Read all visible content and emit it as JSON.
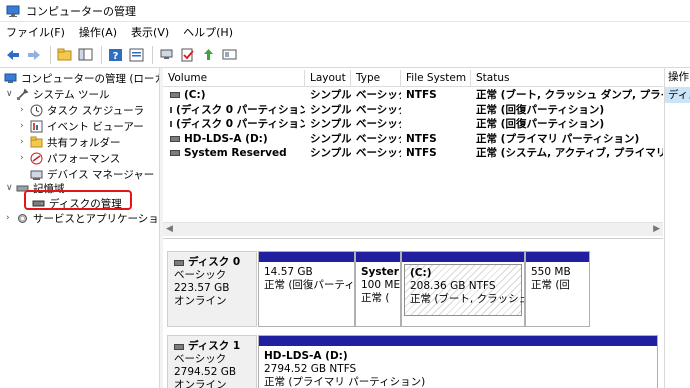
{
  "window": {
    "title": "コンピューターの管理",
    "icon": "computer-management-icon"
  },
  "menu": [
    "ファイル(F)",
    "操作(A)",
    "表示(V)",
    "ヘルプ(H)"
  ],
  "toolbar": {
    "icons": [
      "back-arrow-icon",
      "forward-arrow-icon",
      "up-folder-icon",
      "console-tree-icon",
      "help-icon",
      "properties-icon",
      "connect-icon",
      "check-icon",
      "export-icon",
      "view-icon"
    ]
  },
  "tree": {
    "root": "コンピューターの管理 (ローカル)",
    "system_tools": "システム ツール",
    "task_scheduler": "タスク スケジューラ",
    "event_viewer": "イベント ビューアー",
    "shared_folders": "共有フォルダー",
    "performance": "パフォーマンス",
    "device_manager": "デバイス マネージャー",
    "storage": "記憶域",
    "disk_management": "ディスクの管理",
    "services": "サービスとアプリケーション"
  },
  "volumes": {
    "headers": [
      "Volume",
      "Layout",
      "Type",
      "File System",
      "Status"
    ],
    "rows": [
      {
        "volume": "(C:)",
        "layout": "シンプル",
        "type": "ベーシック",
        "fs": "NTFS",
        "status": "正常 (ブート, クラッシュ ダンプ, プライマリ パ"
      },
      {
        "volume": "(ディスク 0 パーティション 1)",
        "layout": "シンプル",
        "type": "ベーシック",
        "fs": "",
        "status": "正常 (回復パーティション)"
      },
      {
        "volume": "(ディスク 0 パーティション 4)",
        "layout": "シンプル",
        "type": "ベーシック",
        "fs": "",
        "status": "正常 (回復パーティション)"
      },
      {
        "volume": "HD-LDS-A (D:)",
        "layout": "シンプル",
        "type": "ベーシック",
        "fs": "NTFS",
        "status": "正常 (プライマリ パーティション)"
      },
      {
        "volume": "System Reserved",
        "layout": "シンプル",
        "type": "ベーシック",
        "fs": "NTFS",
        "status": "正常 (システム, アクティブ, プライマリ パーテ"
      }
    ]
  },
  "disks": [
    {
      "name": "ディスク 0",
      "type": "ベーシック",
      "size": "223.57 GB",
      "state": "オンライン",
      "partitions": [
        {
          "name": "",
          "size": "14.57 GB",
          "status": "正常 (回復パーティシ"
        },
        {
          "name": "Syster",
          "size": "100 ME",
          "status": "正常 ("
        },
        {
          "name": "(C:)",
          "size": "208.36 GB NTFS",
          "status": "正常 (ブート, クラッシュ ダン"
        },
        {
          "name": "",
          "size": "550 MB",
          "status": "正常 (回"
        }
      ]
    },
    {
      "name": "ディスク 1",
      "type": "ベーシック",
      "size": "2794.52 GB",
      "state": "オンライン",
      "partitions": [
        {
          "name": "HD-LDS-A  (D:)",
          "size": "2794.52 GB NTFS",
          "status": "正常 (プライマリ パーティション)"
        }
      ]
    }
  ],
  "actions": {
    "header": "操作",
    "item": "ディス"
  },
  "colors": {
    "partition_bar": "#1f1fa0",
    "highlight": "#e3151a",
    "selected": "#cce4f7"
  }
}
